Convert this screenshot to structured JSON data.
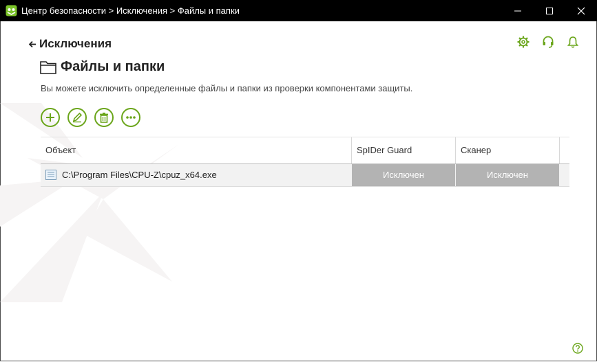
{
  "window": {
    "title": "Центр безопасности > Исключения > Файлы и папки",
    "minimize_icon": "minimize-icon",
    "maximize_icon": "maximize-icon",
    "close_icon": "close-icon"
  },
  "nav": {
    "back_label": "Исключения",
    "icons": [
      "settings-gear-icon",
      "support-headset-icon",
      "notifications-bell-icon"
    ]
  },
  "page": {
    "title": "Файлы и папки",
    "description": "Вы можете исключить определенные файлы и папки из проверки компонентами защиты."
  },
  "toolbar": {
    "buttons": [
      "add-icon",
      "edit-pencil-icon",
      "delete-trash-icon",
      "more-icon"
    ]
  },
  "table": {
    "headers": [
      "Объект",
      "SpIDer Guard",
      "Сканер"
    ],
    "rows": [
      {
        "object": "C:\\Program Files\\CPU-Z\\cpuz_x64.exe",
        "spider_guard": "Исключен",
        "scanner": "Исключен"
      }
    ]
  },
  "colors": {
    "accent": "#6aa51a",
    "titlebar": "#000000",
    "status_bg": "#b3b3b3",
    "row_bg": "#f2f2f2"
  }
}
